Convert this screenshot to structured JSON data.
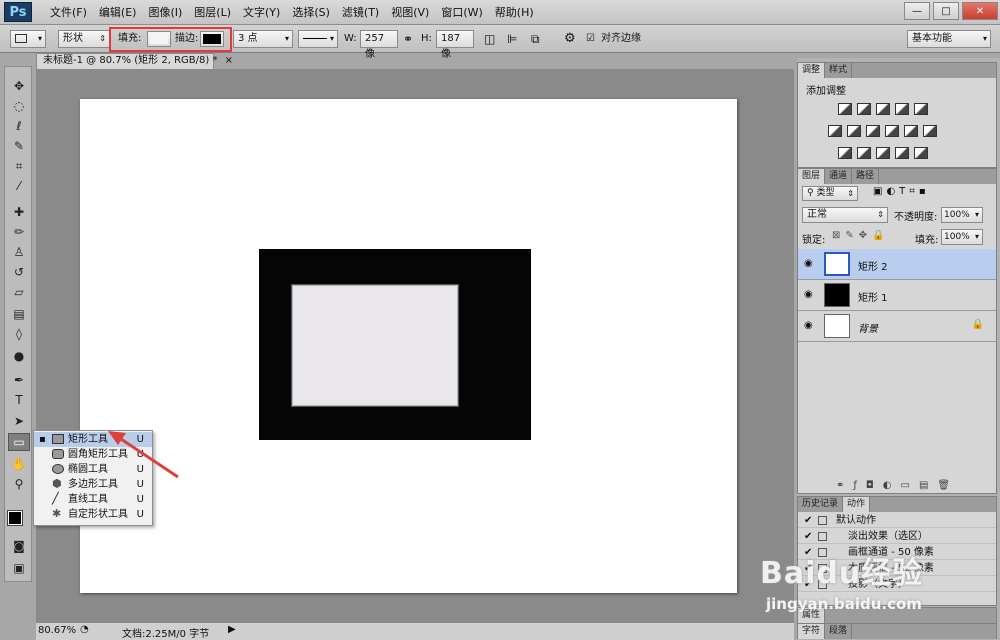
{
  "app": {
    "logo": "Ps"
  },
  "menu": [
    "文件(F)",
    "编辑(E)",
    "图像(I)",
    "图层(L)",
    "文字(Y)",
    "选择(S)",
    "滤镜(T)",
    "视图(V)",
    "窗口(W)",
    "帮助(H)"
  ],
  "window_controls": {
    "minimize": "—",
    "maximize": "□",
    "close": "✕"
  },
  "options": {
    "mode": "形状",
    "fill_label": "填充:",
    "stroke_label": "描边:",
    "stroke_width": "3 点",
    "w_label": "W:",
    "w_value": "257 像",
    "h_label": "H:",
    "h_value": "187 像",
    "align_edges": "对齐边缘",
    "workspace": "基本功能",
    "fill_color": "#f4f4f4",
    "stroke_color": "#000000"
  },
  "document": {
    "tab_title": "未标题-1 @ 80.7% (矩形 2, RGB/8) *",
    "close": "×"
  },
  "status": {
    "zoom": "80.67%",
    "doc_info": "文档:2.25M/0 字节"
  },
  "flyout": [
    {
      "label": "矩形工具",
      "key": "U",
      "selected": true,
      "icon": "rect-icon"
    },
    {
      "label": "圆角矩形工具",
      "key": "U",
      "icon": "rounded-rect-icon"
    },
    {
      "label": "椭圆工具",
      "key": "U",
      "icon": "ellipse-icon"
    },
    {
      "label": "多边形工具",
      "key": "U",
      "icon": "polygon-icon"
    },
    {
      "label": "直线工具",
      "key": "U",
      "icon": "line-icon"
    },
    {
      "label": "自定形状工具",
      "key": "U",
      "icon": "custom-shape-icon"
    }
  ],
  "panels": {
    "adjust_tabs": [
      "调整",
      "样式"
    ],
    "adjust_title": "添加调整",
    "layer_tabs": [
      "图层",
      "通道",
      "路径"
    ],
    "filter_type": "类型",
    "blend_mode": "正常",
    "opacity_label": "不透明度:",
    "opacity_value": "100%",
    "lock_label": "锁定:",
    "fill_label": "填充:",
    "fill_value": "100%",
    "layers": [
      {
        "name": "矩形 2",
        "selected": true
      },
      {
        "name": "矩形 1",
        "selected": false
      },
      {
        "name": "背景",
        "selected": false
      }
    ],
    "history_tabs": [
      "历史记录",
      "动作"
    ],
    "history": [
      {
        "label": "默认动作"
      },
      {
        "label": "淡出效果（选区）"
      },
      {
        "label": "画框通道 - 50 像素"
      },
      {
        "label": "木质画框 - 50 像素"
      },
      {
        "label": "投影（文字）"
      }
    ],
    "bottom_tabs_1": [
      "属性"
    ],
    "bottom_tabs_2": [
      "字符",
      "段落"
    ]
  },
  "watermark": {
    "line1": "Baidu经验",
    "line2": "jingyan.baidu.com"
  }
}
